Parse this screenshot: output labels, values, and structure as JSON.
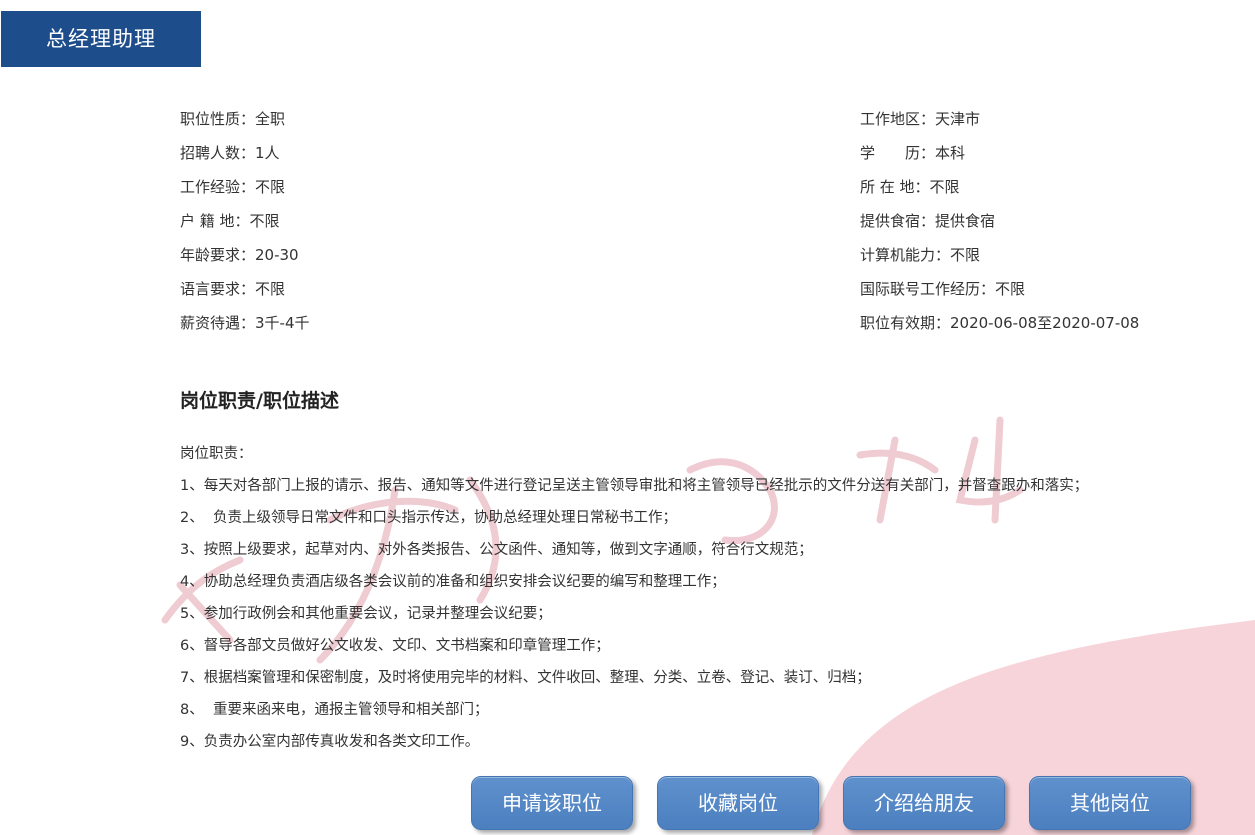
{
  "job_title": "总经理助理",
  "info_left": [
    "职位性质：全职",
    "招聘人数：1人",
    "工作经验：不限",
    "户 籍 地：不限",
    "年龄要求：20-30",
    "语言要求：不限",
    "薪资待遇：3千-4千"
  ],
  "info_right": [
    "工作地区：天津市",
    "学　　历：本科",
    "所 在 地：不限",
    "提供食宿：提供食宿",
    "计算机能力：不限",
    "国际联号工作经历：不限",
    "职位有效期：2020-06-08至2020-07-08"
  ],
  "section_title": "岗位职责/职位描述",
  "duties": [
    "岗位职责：",
    "1、每天对各部门上报的请示、报告、通知等文件进行登记呈送主管领导审批和将主管领导已经批示的文件分送有关部门，并督查跟办和落实；",
    "2、  负责上级领导日常文件和口头指示传达，协助总经理处理日常秘书工作；",
    "3、按照上级要求，起草对内、对外各类报告、公文函件、通知等，做到文字通顺，符合行文规范；",
    "4、协助总经理负责酒店级各类会议前的准备和组织安排会议纪要的编写和整理工作；",
    "5、参加行政例会和其他重要会议，记录并整理会议纪要；",
    "6、督导各部文员做好公文收发、文印、文书档案和印章管理工作；",
    "7、根据档案管理和保密制度，及时将使用完毕的材料、文件收回、整理、分类、立卷、登记、装订、归档；",
    "8、  重要来函来电，通报主管领导和相关部门；",
    "9、负责办公室内部传真收发和各类文印工作。"
  ],
  "buttons": {
    "apply": "申请该职位",
    "favorite": "收藏岗位",
    "share": "介绍给朋友",
    "other": "其他岗位"
  },
  "colors": {
    "title_bg": "#1d4e8b",
    "button_bg": "#5585c5",
    "watermark": "#e3a1ae"
  }
}
